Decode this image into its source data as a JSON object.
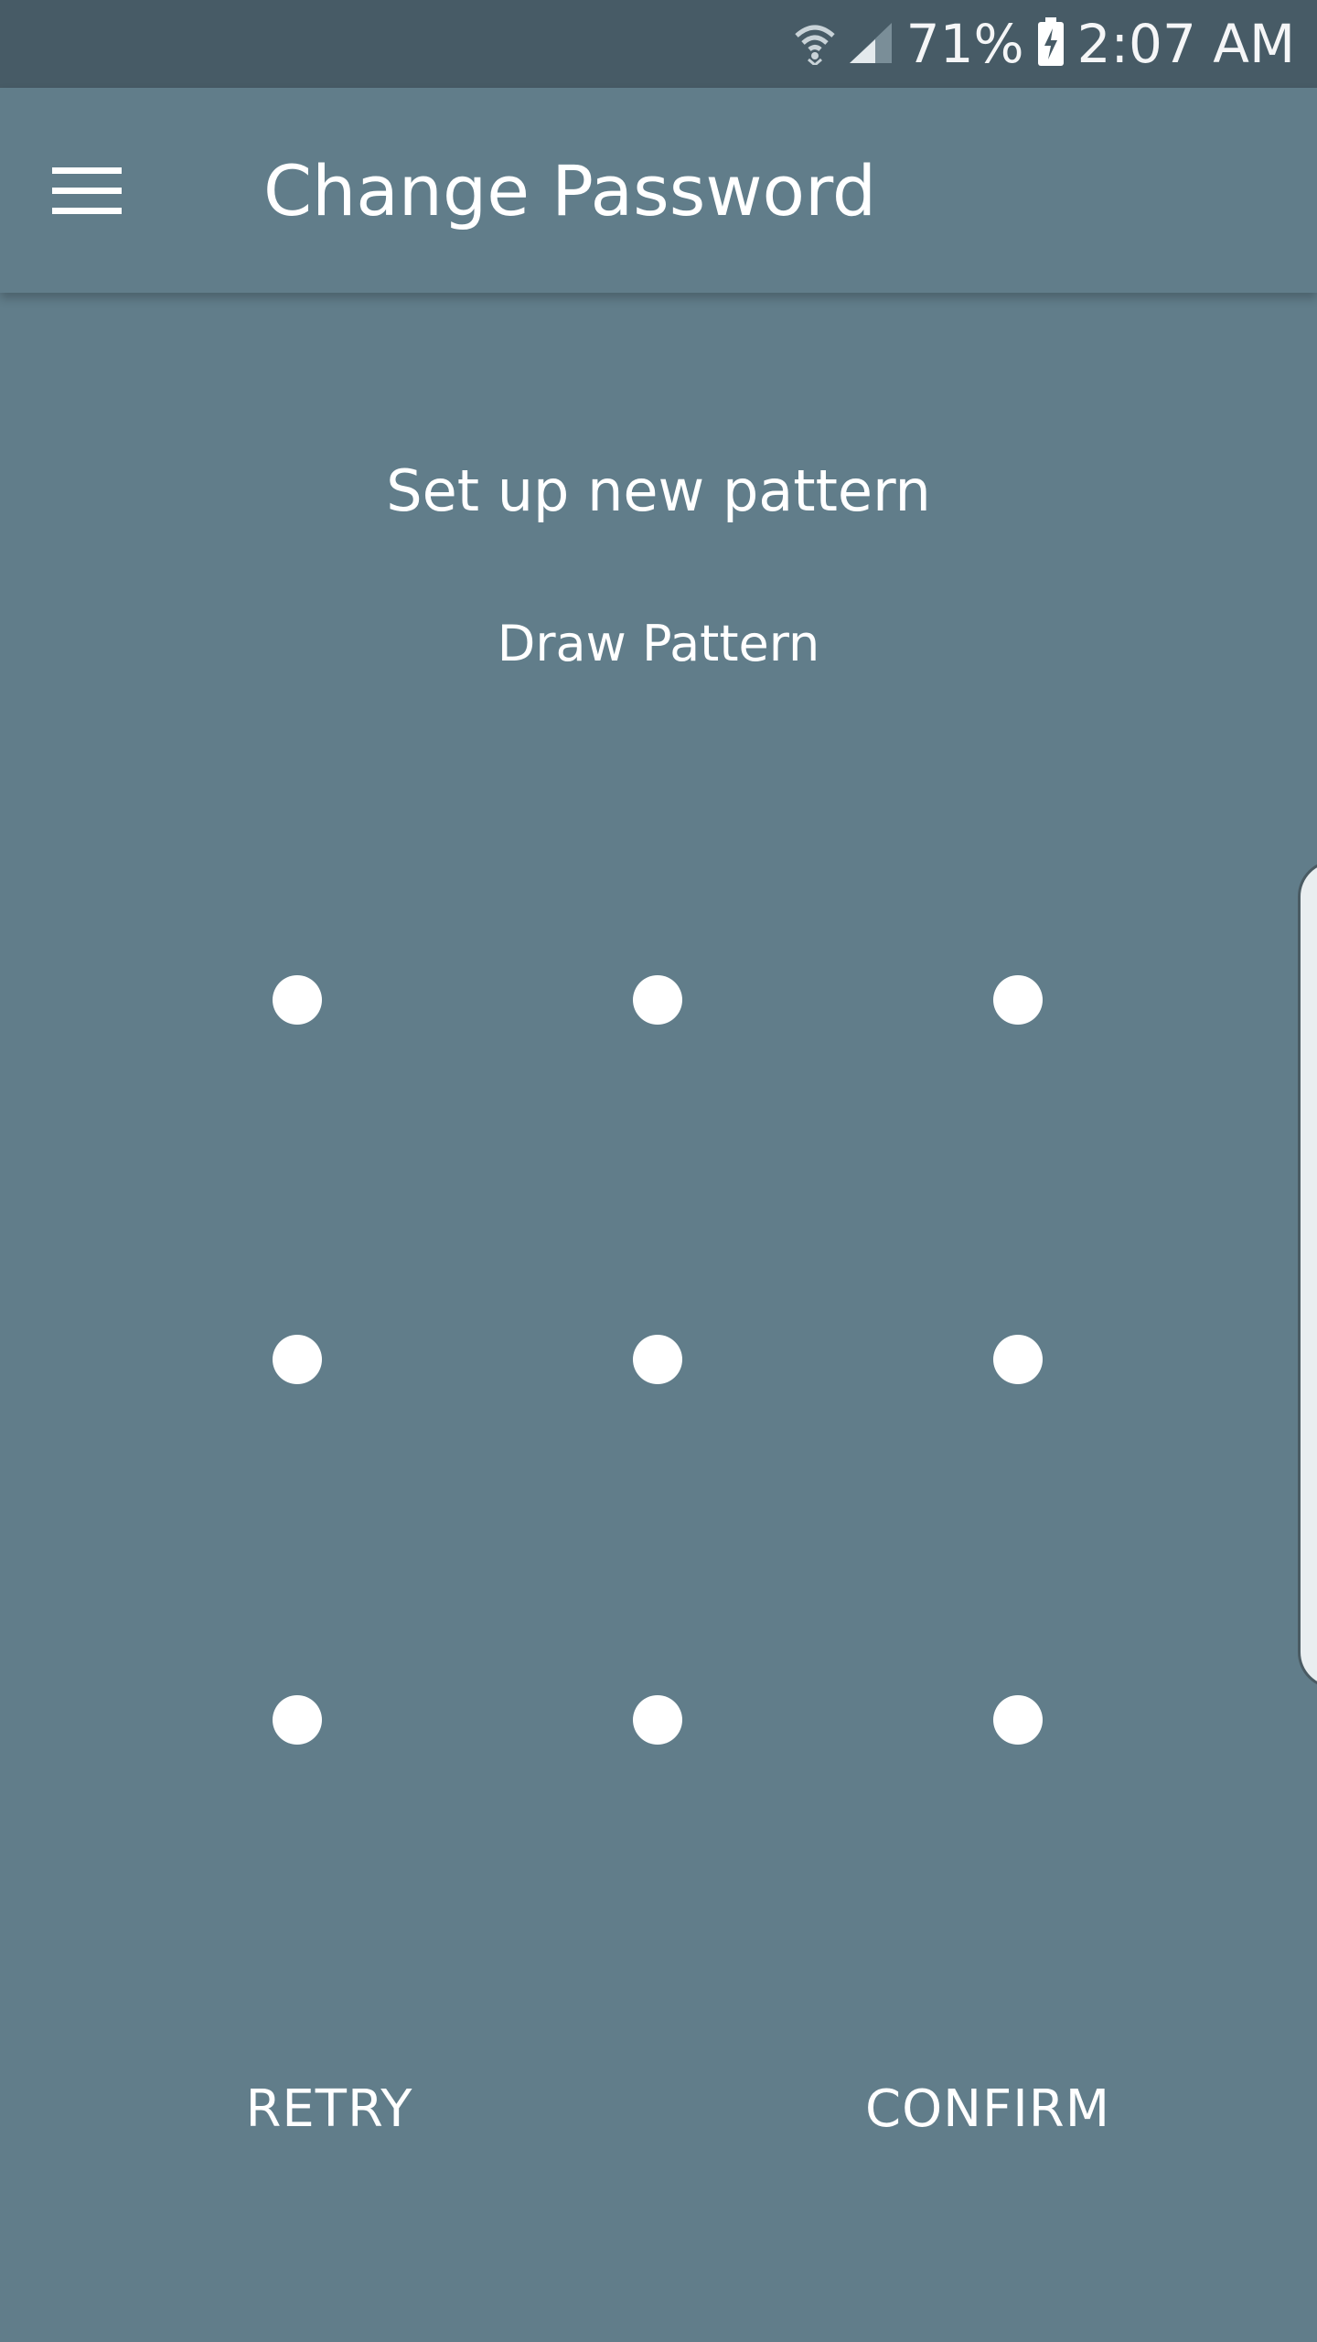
{
  "status_bar": {
    "battery": "71%",
    "time": "2:07 AM",
    "icons": [
      "wifi-icon",
      "signal-icon",
      "battery-charging-icon"
    ]
  },
  "toolbar": {
    "menu_icon": "hamburger-menu-icon",
    "title": "Change Password"
  },
  "main": {
    "heading": "Set up new pattern",
    "instruction": "Draw Pattern",
    "pattern_dots": 9
  },
  "actions": {
    "retry_label": "RETRY",
    "confirm_label": "CONFIRM"
  },
  "colors": {
    "background": "#617d8a",
    "status_bar": "#475b66",
    "dot": "#ffffff",
    "text": "#ffffff"
  }
}
